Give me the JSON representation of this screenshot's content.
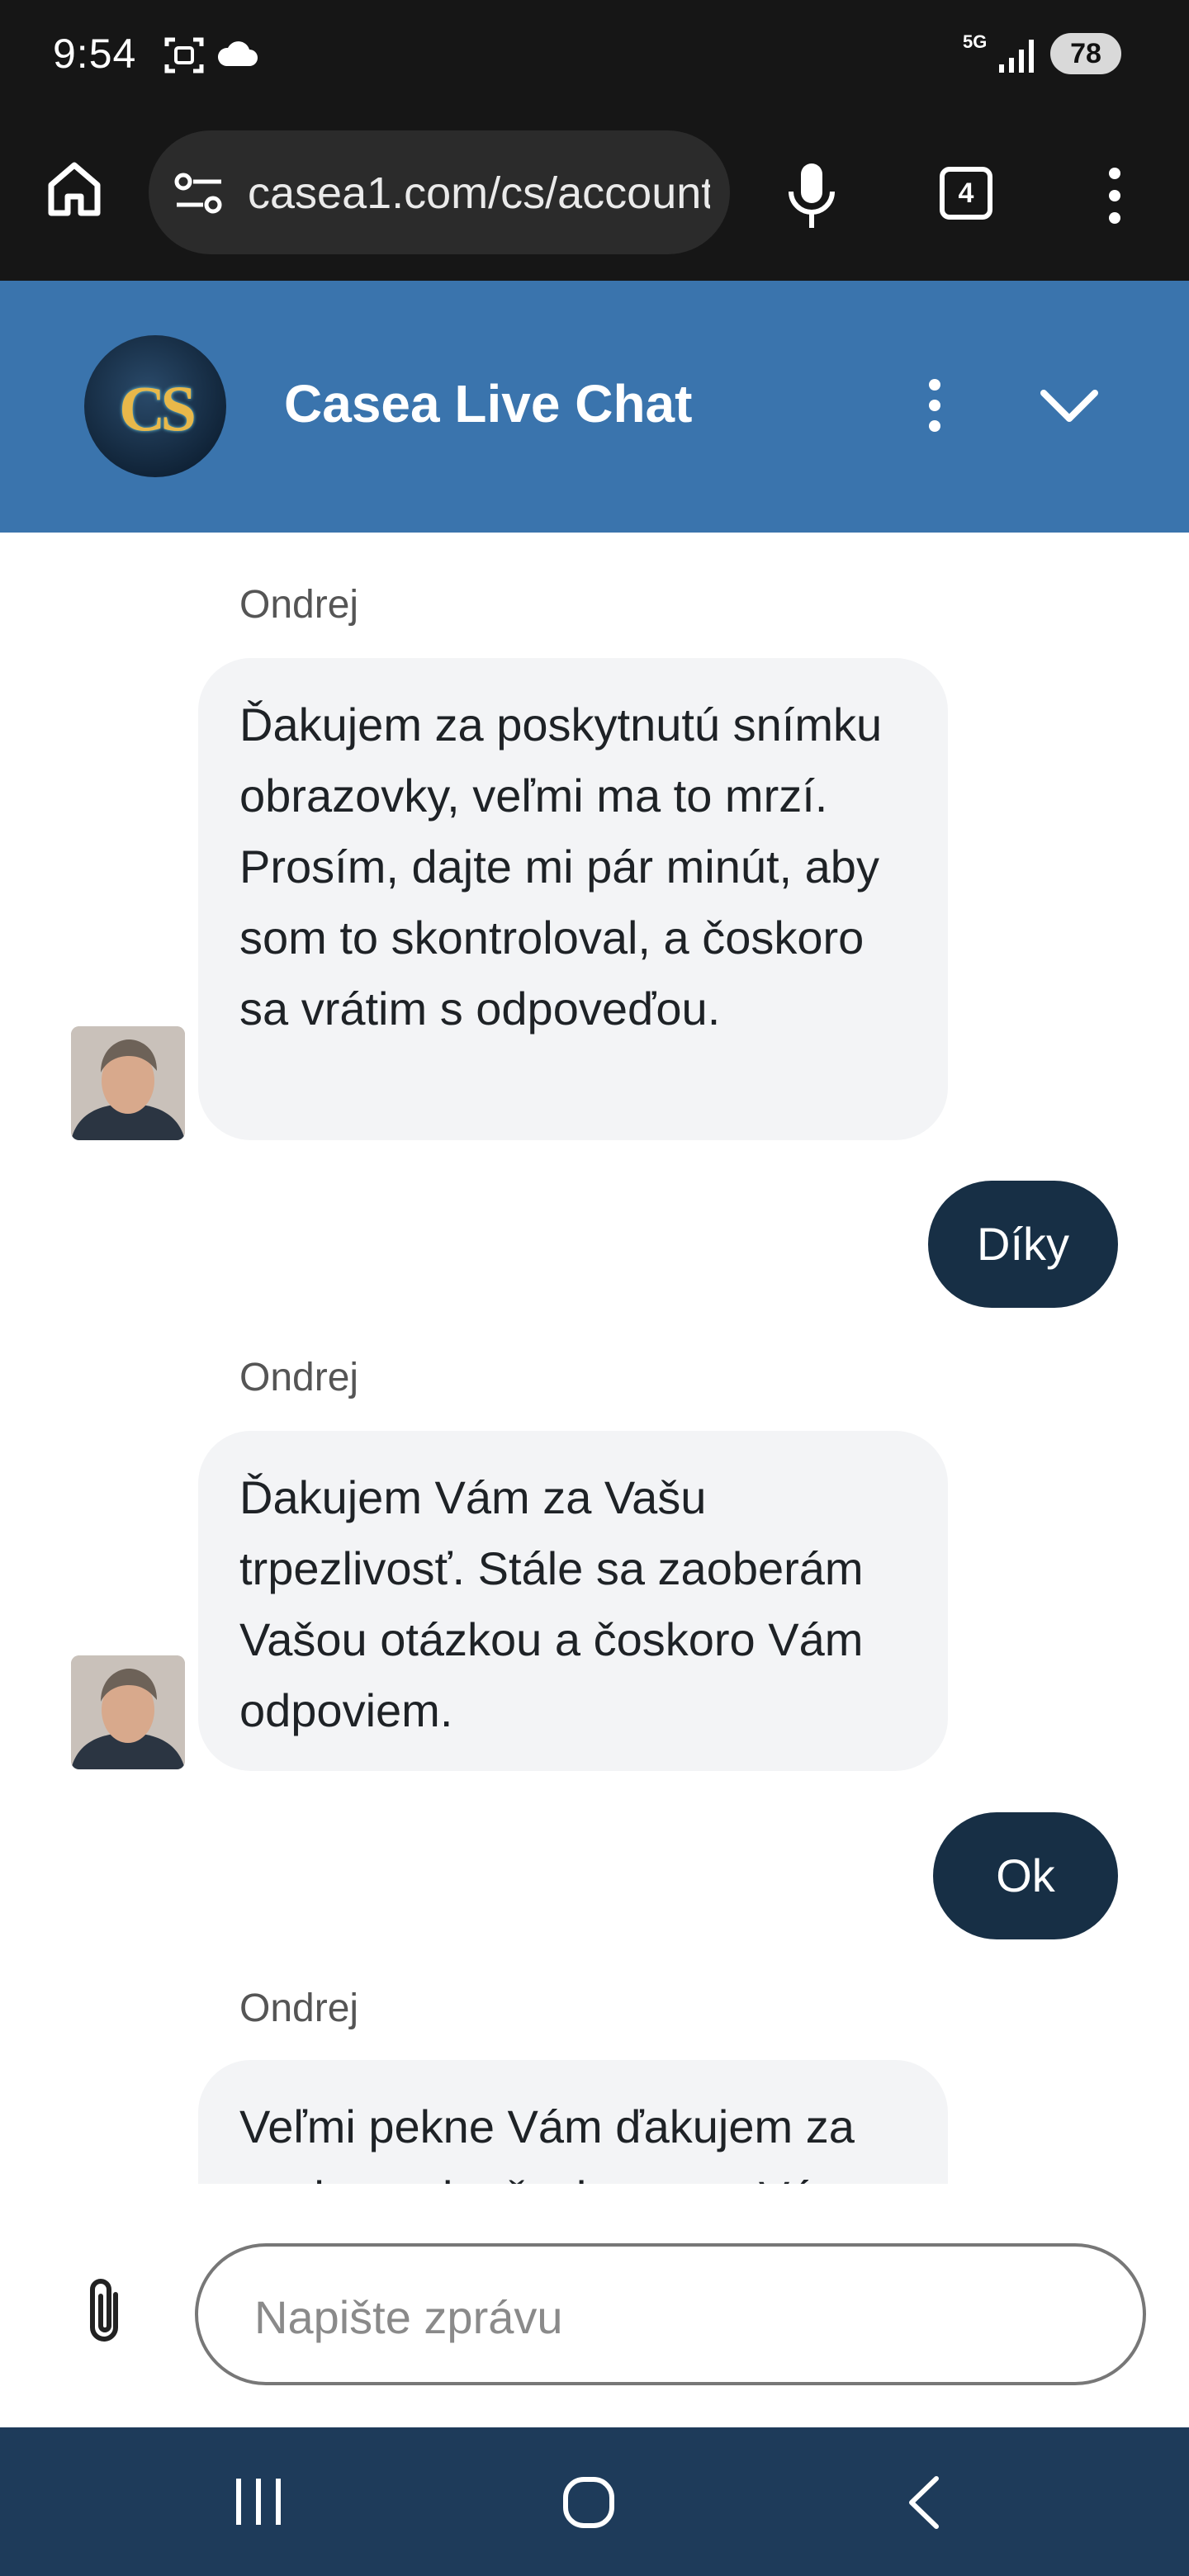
{
  "status_bar": {
    "time": "9:54",
    "network": "5G",
    "battery": "78"
  },
  "browser": {
    "url": "casea1.com/cs/account",
    "tab_count": "4"
  },
  "chat": {
    "title": "Casea Live Chat",
    "logo_text": "CS",
    "messages": [
      {
        "type": "incoming",
        "sender": "Ondrej",
        "text": "Ďakujem za poskytnutú snímku obrazovky, veľmi ma to mrzí. Prosím, dajte mi pár minút, aby som to skontroloval, a čoskoro sa vrátim s odpoveďou."
      },
      {
        "type": "outgoing",
        "text": "Díky"
      },
      {
        "type": "incoming",
        "sender": "Ondrej",
        "text": "Ďakujem Vám za Vašu trpezlivosť. Stále sa zaoberám Vašou otázkou a čoskoro Vám odpoviem."
      },
      {
        "type": "outgoing",
        "text": "Ok"
      },
      {
        "type": "incoming",
        "sender": "Ondrej",
        "text": "Veľmi pekne Vám ďakujem za pochopenie, čoskoro pre Vás"
      }
    ]
  },
  "composer": {
    "placeholder": "Napište zprávu"
  },
  "colors": {
    "header_bg": "#3a74ad",
    "outgoing_bubble": "#172f45",
    "incoming_bubble": "#f3f4f6",
    "navbar_bg": "#1e3b5a"
  },
  "icons": {
    "status": [
      "screenshot-icon",
      "cloud-icon",
      "signal-icon"
    ],
    "toolbar": [
      "home-icon",
      "site-settings-icon",
      "mic-icon",
      "tabs-icon",
      "more-vert-icon"
    ],
    "header": [
      "more-vert-icon",
      "chevron-down-icon"
    ],
    "composer": [
      "paperclip-icon"
    ],
    "navbar": [
      "recents-icon",
      "home-circle-icon",
      "back-icon"
    ]
  }
}
